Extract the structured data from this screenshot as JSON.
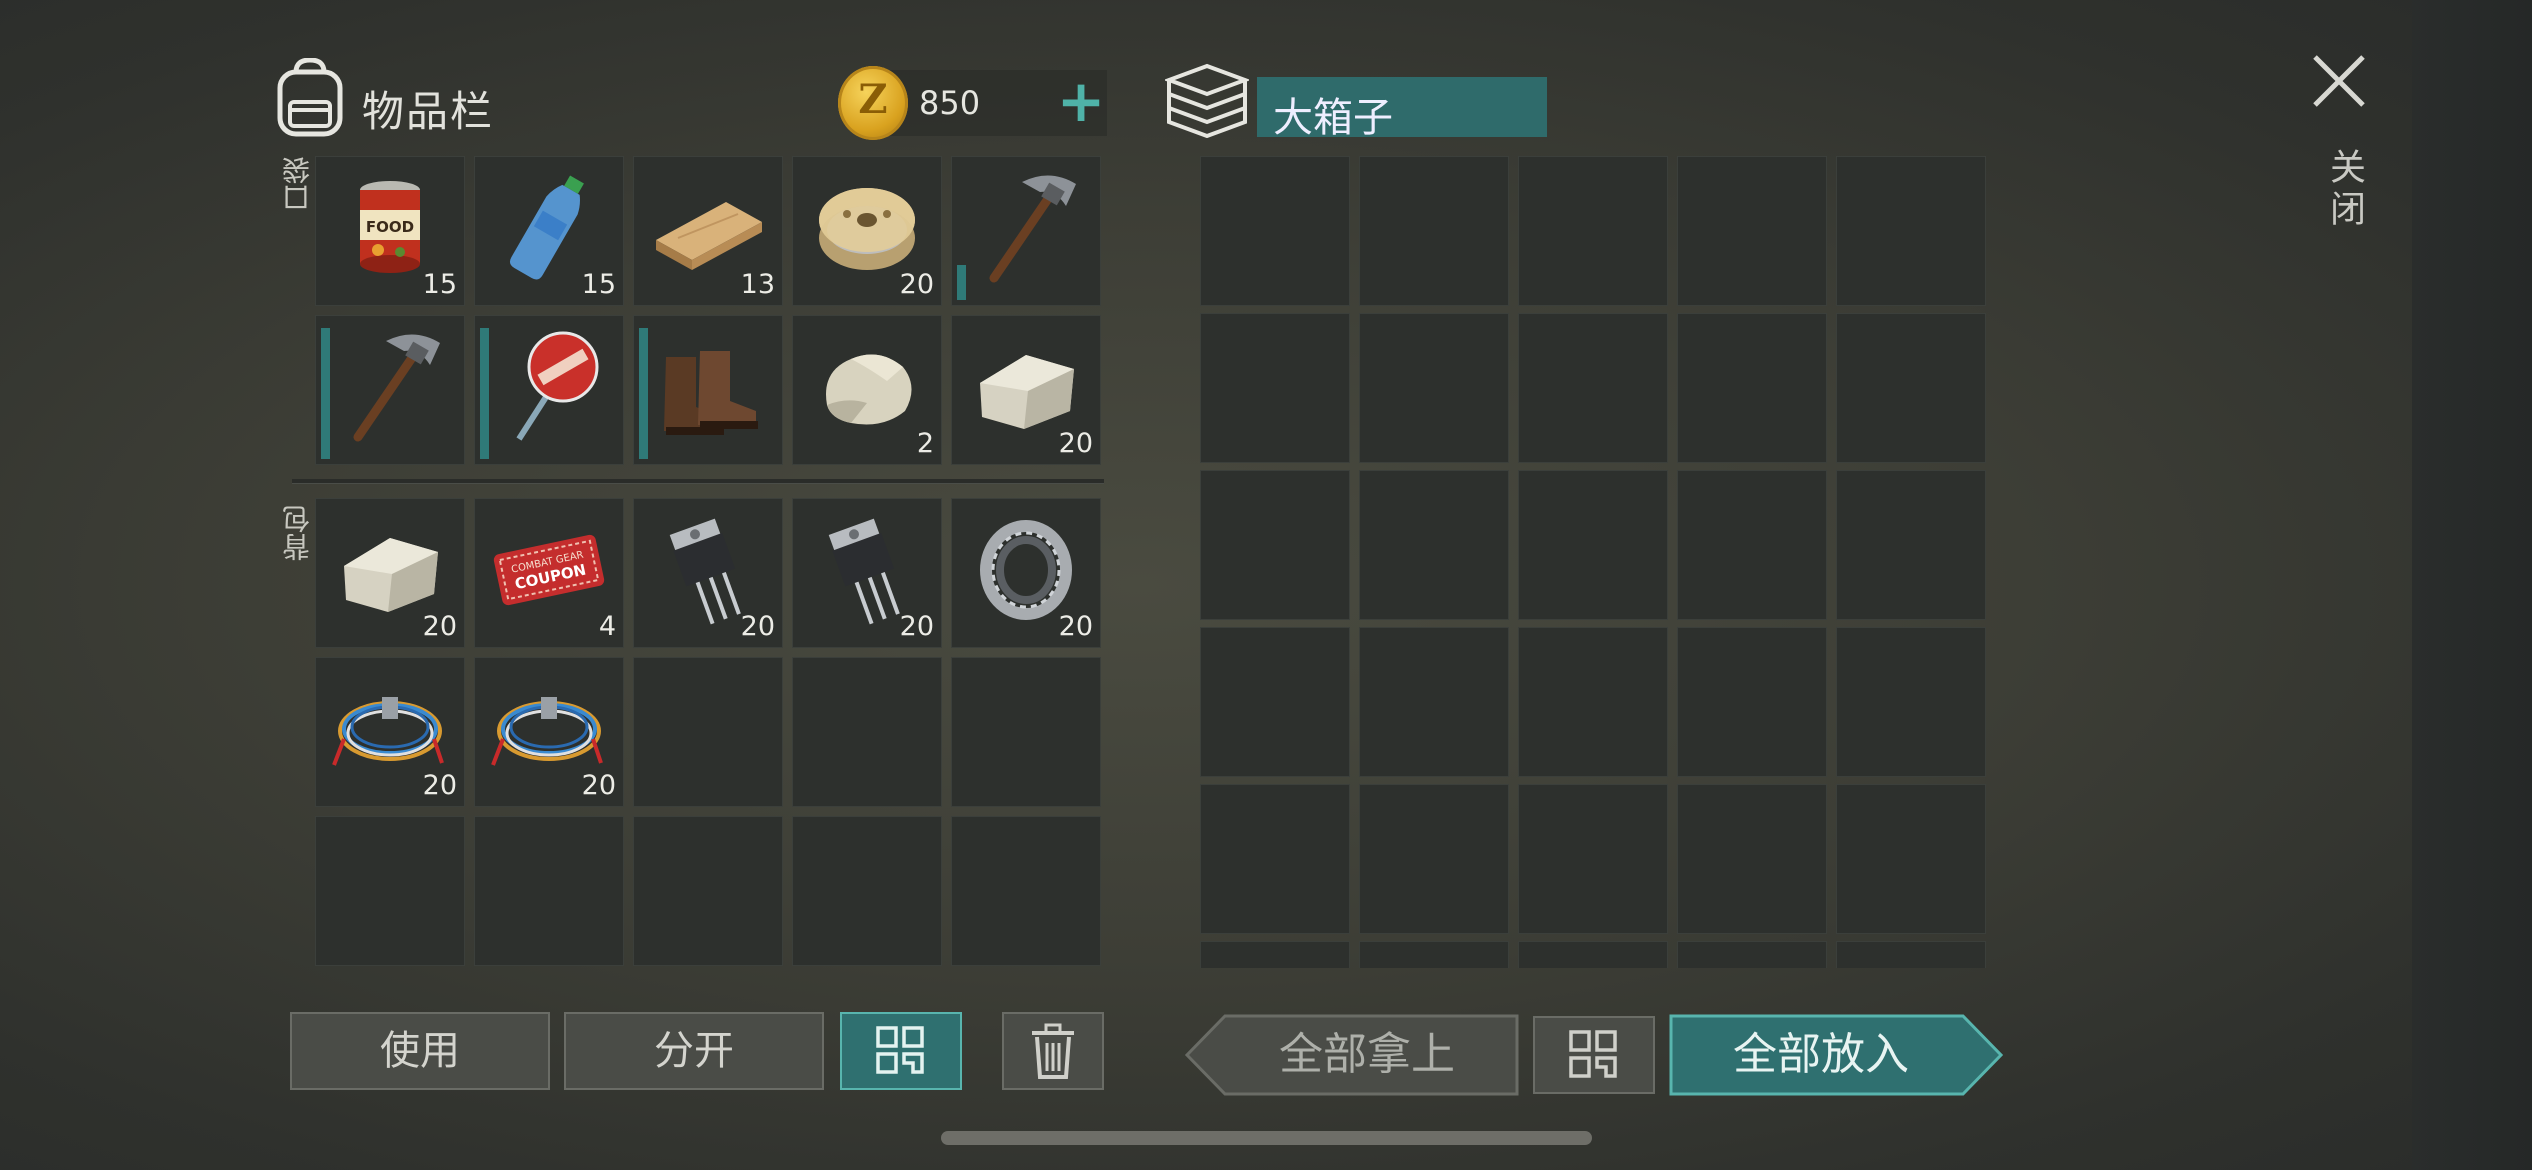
{
  "inventory": {
    "title": "物品栏",
    "coins": "850",
    "coin_symbol": "Z",
    "pocket_label": "口袋",
    "backpack_label": "背包",
    "pocket_slots": [
      {
        "item": "canned-food-icon",
        "qty": "15"
      },
      {
        "item": "water-bottle-icon",
        "qty": "15"
      },
      {
        "item": "wood-plank-icon",
        "qty": "13"
      },
      {
        "item": "wire-spool-icon",
        "qty": "20"
      },
      {
        "item": "pickaxe-icon",
        "qty": "",
        "durability": 0.25
      },
      {
        "item": "pickaxe-icon",
        "qty": "",
        "durability": 0.95
      },
      {
        "item": "stop-sign-icon",
        "qty": "",
        "durability": 0.95
      },
      {
        "item": "boots-icon",
        "qty": "",
        "durability": 0.95
      },
      {
        "item": "stone-icon",
        "qty": "2"
      },
      {
        "item": "limestone-icon",
        "qty": "20"
      }
    ],
    "backpack_slots": [
      {
        "item": "limestone-icon",
        "qty": "20"
      },
      {
        "item": "coupon-icon",
        "qty": "4",
        "text1": "COMBAT GEAR",
        "text2": "COUPON"
      },
      {
        "item": "transistor-icon",
        "qty": "20"
      },
      {
        "item": "transistor-icon",
        "qty": "20"
      },
      {
        "item": "bearing-icon",
        "qty": "20"
      },
      {
        "item": "wires-icon",
        "qty": "20"
      },
      {
        "item": "wires-icon",
        "qty": "20"
      },
      {
        "item": "",
        "qty": ""
      },
      {
        "item": "",
        "qty": ""
      },
      {
        "item": "",
        "qty": ""
      },
      {
        "item": "",
        "qty": ""
      },
      {
        "item": "",
        "qty": ""
      },
      {
        "item": "",
        "qty": ""
      },
      {
        "item": "",
        "qty": ""
      },
      {
        "item": "",
        "qty": ""
      }
    ]
  },
  "container": {
    "title": "大箱子"
  },
  "close_label": "关闭",
  "buttons": {
    "use": "使用",
    "split": "分开",
    "take_all": "全部拿上",
    "put_all": "全部放入"
  },
  "colors": {
    "accent": "#2f7070",
    "accent_border": "#58b5ae",
    "coin": "#d9a21f"
  }
}
